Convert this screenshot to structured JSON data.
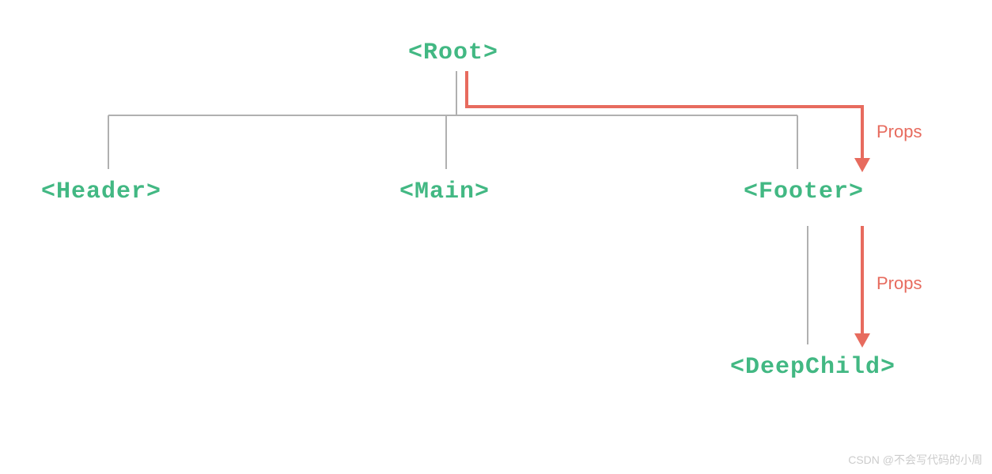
{
  "nodes": {
    "root": "<Root>",
    "header": "<Header>",
    "main": "<Main>",
    "footer": "<Footer>",
    "deepchild": "<DeepChild>"
  },
  "labels": {
    "props1": "Props",
    "props2": "Props"
  },
  "watermark": "CSDN @不会写代码的小周",
  "colors": {
    "node": "#42b883",
    "arrow": "#e76b5e",
    "line": "#b0b0b0"
  }
}
